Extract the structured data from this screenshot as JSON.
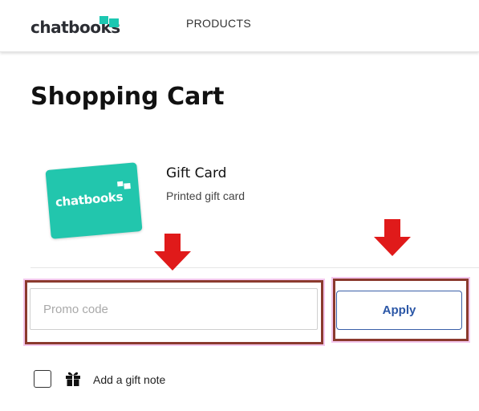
{
  "header": {
    "logo_text": "chatbooks",
    "nav": {
      "products_label": "PRODUCTS"
    }
  },
  "page": {
    "title": "Shopping Cart"
  },
  "cart_item": {
    "image_text": "chatbooks",
    "name": "Gift Card",
    "description": "Printed gift card"
  },
  "promo": {
    "placeholder": "Promo code",
    "value": "",
    "apply_label": "Apply"
  },
  "gift_note": {
    "label": "Add a gift note",
    "checked": false,
    "icon": "gift-icon"
  },
  "colors": {
    "brand": "#1cc7b1",
    "apply_text": "#2a56a6",
    "annotation_arrow": "#e01a1a",
    "annotation_box": "#8b3a2e"
  }
}
